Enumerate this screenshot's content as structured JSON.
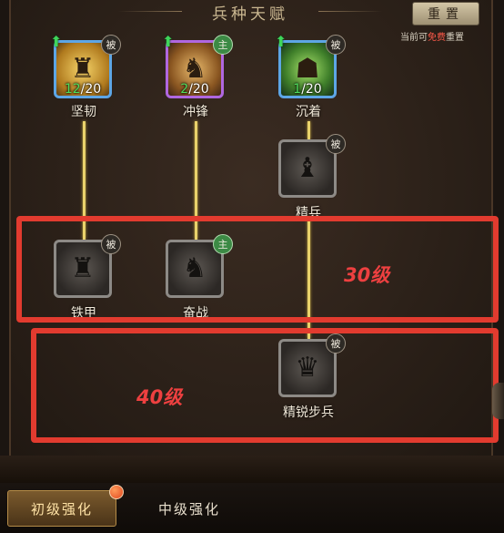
{
  "header": {
    "title": "兵种天赋",
    "reset_label": "重置",
    "reset_hint_prefix": "当前可",
    "reset_hint_free": "免费",
    "reset_hint_suffix": "重置"
  },
  "talents": {
    "jianren": {
      "label": "坚韧",
      "current": "12",
      "max": "/20",
      "badge": "被",
      "glyph": "♜"
    },
    "chongfeng": {
      "label": "冲锋",
      "current": "2",
      "max": "/20",
      "badge": "主",
      "glyph": "♞"
    },
    "chenzhuo": {
      "label": "沉着",
      "current": "1",
      "max": "/20",
      "badge": "被",
      "glyph": "☗"
    },
    "jingbing": {
      "label": "精兵",
      "badge": "被",
      "glyph": "♝"
    },
    "tiejia": {
      "label": "铁甲",
      "badge": "被",
      "glyph": "♜"
    },
    "fenzhan": {
      "label": "奋战",
      "badge": "主",
      "glyph": "♞"
    },
    "jingruibubing": {
      "label": "精锐步兵",
      "badge": "被",
      "glyph": "♛"
    }
  },
  "annotations": {
    "level30": "30级",
    "level40": "40级"
  },
  "tabs": {
    "primary": "初级强化",
    "intermediate": "中级强化"
  },
  "colors": {
    "highlight_box": "#e23b2f",
    "connector": "#e9d26b",
    "level_green": "#4fdc5c"
  }
}
